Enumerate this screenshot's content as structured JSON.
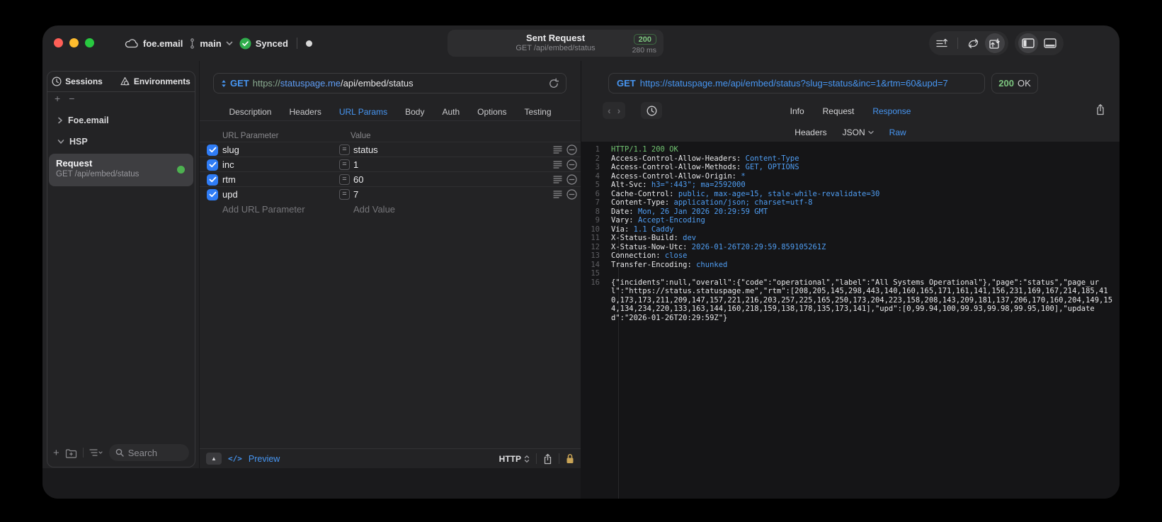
{
  "colors": {
    "accent_blue": "#4796f2",
    "green": "#7dc67f",
    "checkbox_blue": "#2f7cf5",
    "lock_gold": "#c9a456"
  },
  "titlebar": {
    "project": "foe.email",
    "branch": "main",
    "sync_label": "Synced",
    "request_summary": {
      "title": "Sent Request",
      "method_path": "GET /api/embed/status",
      "status_code": "200",
      "duration": "280 ms"
    }
  },
  "sidebar": {
    "tabs": [
      {
        "label": "Sessions",
        "icon": "clock-icon"
      },
      {
        "label": "Environments",
        "icon": "environments-icon"
      }
    ],
    "tree": [
      {
        "label": "Foe.email",
        "expanded": false
      },
      {
        "label": "HSP",
        "expanded": true
      }
    ],
    "request_item": {
      "title": "Request",
      "subtitle": "GET /api/embed/status"
    },
    "search_placeholder": "Search"
  },
  "editor": {
    "method": "GET",
    "url": {
      "scheme": "https://",
      "host": "statuspage.me",
      "path": "/api/embed/status"
    },
    "tabs": [
      {
        "label": "Description"
      },
      {
        "label": "Headers"
      },
      {
        "label": "URL Params",
        "active": true
      },
      {
        "label": "Body"
      },
      {
        "label": "Auth"
      },
      {
        "label": "Options"
      },
      {
        "label": "Testing"
      }
    ],
    "params": {
      "columns": [
        "URL Parameter",
        "Value"
      ],
      "rows": [
        {
          "name": "slug",
          "value": "status",
          "checked": true
        },
        {
          "name": "inc",
          "value": "1",
          "checked": true
        },
        {
          "name": "rtm",
          "value": "60",
          "checked": true
        },
        {
          "name": "upd",
          "value": "7",
          "checked": true
        }
      ],
      "add_name_placeholder": "Add URL Parameter",
      "add_value_placeholder": "Add Value"
    },
    "footer": {
      "preview": "Preview",
      "protocol": "HTTP"
    }
  },
  "response": {
    "request_line": {
      "method": "GET",
      "url": "https://statuspage.me/api/embed/status?slug=status&inc=1&rtm=60&upd=7"
    },
    "status": {
      "code": "200",
      "text": "OK"
    },
    "tabs": [
      {
        "label": "Info"
      },
      {
        "label": "Request"
      },
      {
        "label": "Response",
        "active": true
      }
    ],
    "subtabs": [
      {
        "label": "Headers"
      },
      {
        "label": "JSON",
        "dropdown": true
      },
      {
        "label": "Raw",
        "active": true
      }
    ],
    "lines": [
      {
        "n": "1",
        "parts": [
          {
            "t": "HTTP/1.1 200 OK",
            "c": "green"
          }
        ]
      },
      {
        "n": "2",
        "parts": [
          {
            "t": "Access-Control-Allow-Headers: ",
            "c": "plain"
          },
          {
            "t": "Content-Type",
            "c": "blue"
          }
        ]
      },
      {
        "n": "3",
        "parts": [
          {
            "t": "Access-Control-Allow-Methods: ",
            "c": "plain"
          },
          {
            "t": "GET, OPTIONS",
            "c": "blue"
          }
        ]
      },
      {
        "n": "4",
        "parts": [
          {
            "t": "Access-Control-Allow-Origin: ",
            "c": "plain"
          },
          {
            "t": "*",
            "c": "blue"
          }
        ]
      },
      {
        "n": "5",
        "parts": [
          {
            "t": "Alt-Svc: ",
            "c": "plain"
          },
          {
            "t": "h3=\":443\"; ma=2592000",
            "c": "blue"
          }
        ]
      },
      {
        "n": "6",
        "parts": [
          {
            "t": "Cache-Control: ",
            "c": "plain"
          },
          {
            "t": "public, max-age=15, stale-while-revalidate=30",
            "c": "blue"
          }
        ]
      },
      {
        "n": "7",
        "parts": [
          {
            "t": "Content-Type: ",
            "c": "plain"
          },
          {
            "t": "application/json; charset=utf-8",
            "c": "blue"
          }
        ]
      },
      {
        "n": "8",
        "parts": [
          {
            "t": "Date: ",
            "c": "plain"
          },
          {
            "t": "Mon, 26 Jan 2026 20:29:59 GMT",
            "c": "blue"
          }
        ]
      },
      {
        "n": "9",
        "parts": [
          {
            "t": "Vary: ",
            "c": "plain"
          },
          {
            "t": "Accept-Encoding",
            "c": "blue"
          }
        ]
      },
      {
        "n": "10",
        "parts": [
          {
            "t": "Via: ",
            "c": "plain"
          },
          {
            "t": "1.1 Caddy",
            "c": "blue"
          }
        ]
      },
      {
        "n": "11",
        "parts": [
          {
            "t": "X-Status-Build: ",
            "c": "plain"
          },
          {
            "t": "dev",
            "c": "blue"
          }
        ]
      },
      {
        "n": "12",
        "parts": [
          {
            "t": "X-Status-Now-Utc: ",
            "c": "plain"
          },
          {
            "t": "2026-01-26T20:29:59.859105261Z",
            "c": "blue"
          }
        ]
      },
      {
        "n": "13",
        "parts": [
          {
            "t": "Connection: ",
            "c": "plain"
          },
          {
            "t": "close",
            "c": "blue"
          }
        ]
      },
      {
        "n": "14",
        "parts": [
          {
            "t": "Transfer-Encoding: ",
            "c": "plain"
          },
          {
            "t": "chunked",
            "c": "blue"
          }
        ]
      },
      {
        "n": "15",
        "parts": []
      },
      {
        "n": "16",
        "parts": [
          {
            "t": "{\"incidents\":null,\"overall\":{\"code\":\"operational\",\"label\":\"All Systems Operational\"},\"page\":\"status\",\"page_url\":\"https://status.statuspage.me\",\"rtm\":[208,205,145,298,443,140,160,165,171,161,141,156,231,169,167,214,185,410,173,173,211,209,147,157,221,216,203,257,225,165,250,173,204,223,158,208,143,209,181,137,206,170,160,204,149,154,134,234,220,133,163,144,160,218,159,138,178,135,173,141],\"upd\":[0,99.94,100,99.93,99.98,99.95,100],\"updated\":\"2026-01-26T20:29:59Z\"}",
            "c": "plain"
          }
        ]
      }
    ]
  }
}
